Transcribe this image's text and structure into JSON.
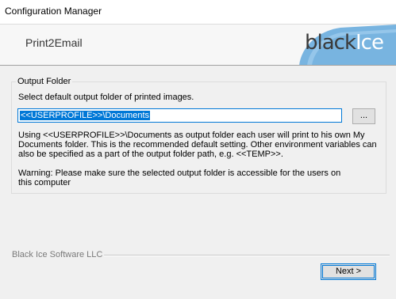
{
  "window": {
    "title": "Configuration Manager"
  },
  "header": {
    "product": "Print2Email",
    "logo_word1": "black",
    "logo_word2": "Ice"
  },
  "colors": {
    "logo_blue": "#78b4e0",
    "accent": "#0078d7"
  },
  "output_folder": {
    "legend": "Output Folder",
    "label": "Select default output folder of printed images.",
    "path_value": "<<USERPROFILE>>\\Documents",
    "browse_label": "...",
    "info": "Using <<USERPROFILE>>\\Documents as output folder each user will print to his own My Documents folder. This is the recommended default setting. Other environment variables can also be specified as a part of the output folder path, e.g. <<TEMP>>.",
    "warning": "Warning:  Please make sure the selected output folder is accessible for the users on this computer"
  },
  "footer": {
    "company": "Black Ice Software LLC",
    "next_label": "Next >"
  }
}
